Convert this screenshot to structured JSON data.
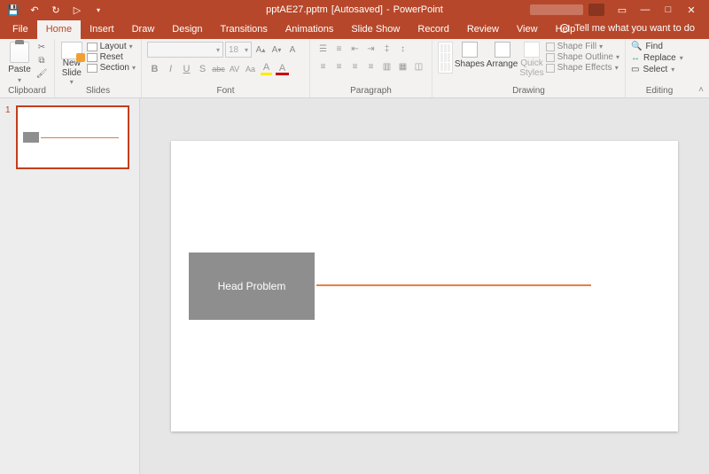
{
  "titlebar": {
    "filename": "pptAE27.pptm",
    "autosaved": "[Autosaved]",
    "separator": "-",
    "app": "PowerPoint"
  },
  "tabs": {
    "file": "File",
    "home": "Home",
    "insert": "Insert",
    "draw": "Draw",
    "design": "Design",
    "transitions": "Transitions",
    "animations": "Animations",
    "slideshow": "Slide Show",
    "record": "Record",
    "review": "Review",
    "view": "View",
    "help": "Help"
  },
  "tellme": "Tell me what you want to do",
  "ribbon": {
    "clipboard": {
      "label": "Clipboard",
      "paste": "Paste"
    },
    "slides": {
      "label": "Slides",
      "new": "New Slide",
      "layout": "Layout",
      "reset": "Reset",
      "section": "Section"
    },
    "font": {
      "label": "Font",
      "size": "18",
      "bold": "B",
      "italic": "I",
      "underline": "U",
      "shadow": "S",
      "strike": "abc",
      "spacing": "AV",
      "case": "Aa",
      "fontcolor": "A"
    },
    "paragraph": {
      "label": "Paragraph"
    },
    "drawing": {
      "label": "Drawing",
      "shapes": "Shapes",
      "arrange": "Arrange",
      "quick": "Quick Styles",
      "fill": "Shape Fill",
      "outline": "Shape Outline",
      "effects": "Shape Effects"
    },
    "editing": {
      "label": "Editing",
      "find": "Find",
      "replace": "Replace",
      "select": "Select"
    }
  },
  "thumbs": {
    "num1": "1"
  },
  "slide": {
    "title": "Head Problem"
  }
}
